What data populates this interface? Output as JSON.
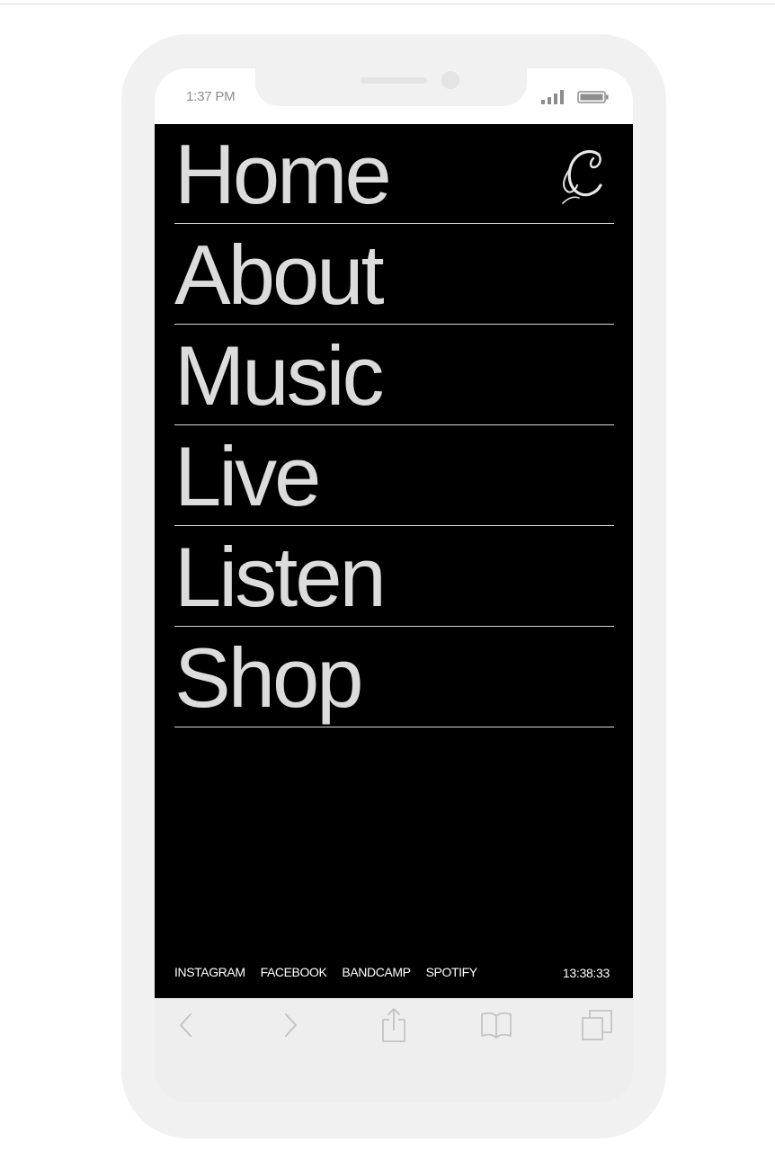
{
  "status_bar": {
    "time": "1:37 PM"
  },
  "menu": {
    "items": [
      {
        "label": "Home"
      },
      {
        "label": "About"
      },
      {
        "label": "Music"
      },
      {
        "label": "Live"
      },
      {
        "label": "Listen"
      },
      {
        "label": "Shop"
      }
    ],
    "logo_icon": "script-c-logo-icon"
  },
  "footer": {
    "links": [
      "INSTAGRAM",
      "FACEBOOK",
      "BANDCAMP",
      "SPOTIFY"
    ],
    "clock": "13:38:33"
  },
  "browser_toolbar": {
    "icons": [
      "back-icon",
      "forward-icon",
      "share-icon",
      "bookmarks-icon",
      "tabs-icon"
    ]
  },
  "colors": {
    "screen_bg": "#000000",
    "menu_text": "#dcdcdc",
    "divider": "#d9d9d9",
    "phone_frame": "#f1f1f1"
  }
}
